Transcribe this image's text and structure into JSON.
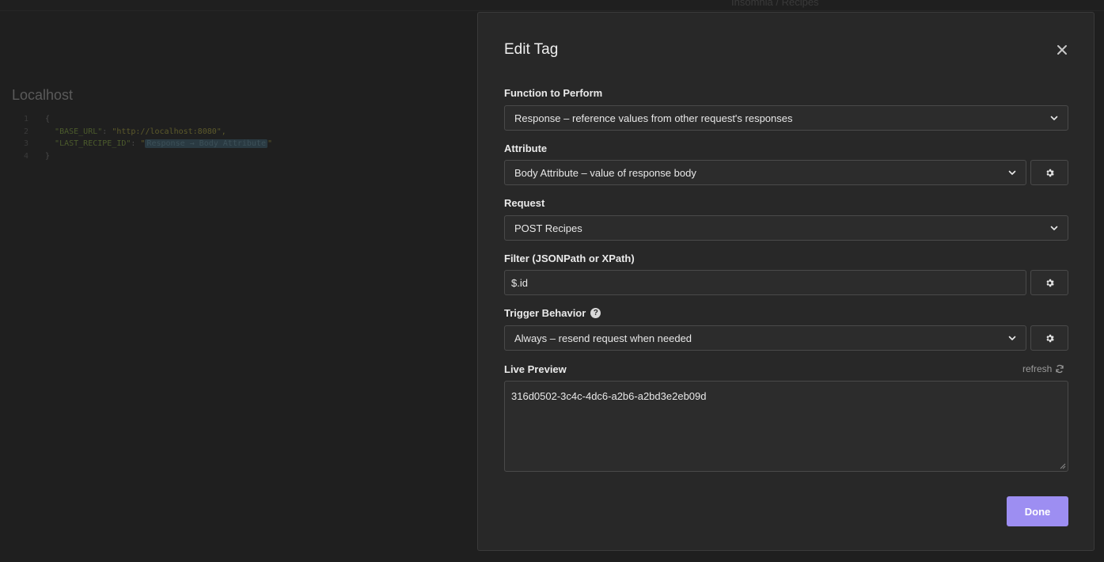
{
  "background": {
    "breadcrumb": "Insomnia / Recipes",
    "environment_title": "Localhost",
    "editor_lines": [
      {
        "num": "1",
        "text": "{"
      },
      {
        "num": "2",
        "key": "\"BASE_URL\"",
        "value": "\"http://localhost:8080\","
      },
      {
        "num": "3",
        "key": "\"LAST_RECIPE_ID\"",
        "tag": "Response → Body Attribute"
      },
      {
        "num": "4",
        "text": "}"
      }
    ]
  },
  "modal": {
    "title": "Edit Tag",
    "close_icon": "close-icon",
    "function_label": "Function to Perform",
    "function_value": "Response – reference values from other request's responses",
    "attribute_label": "Attribute",
    "attribute_value": "Body Attribute – value of response body",
    "request_label": "Request",
    "request_value": "POST Recipes",
    "filter_label": "Filter (JSONPath or XPath)",
    "filter_value": "$.id",
    "trigger_label": "Trigger Behavior",
    "trigger_help_icon": "?",
    "trigger_value": "Always – resend request when needed",
    "preview_label": "Live Preview",
    "refresh_label": "refresh",
    "preview_value": "316d0502-3c4c-4dc6-a2b6-a2bd3e2eb09d",
    "done_label": "Done"
  },
  "colors": {
    "accent": "#9d8ef2",
    "modal_bg": "#282828",
    "page_bg": "#1f1f1f"
  }
}
